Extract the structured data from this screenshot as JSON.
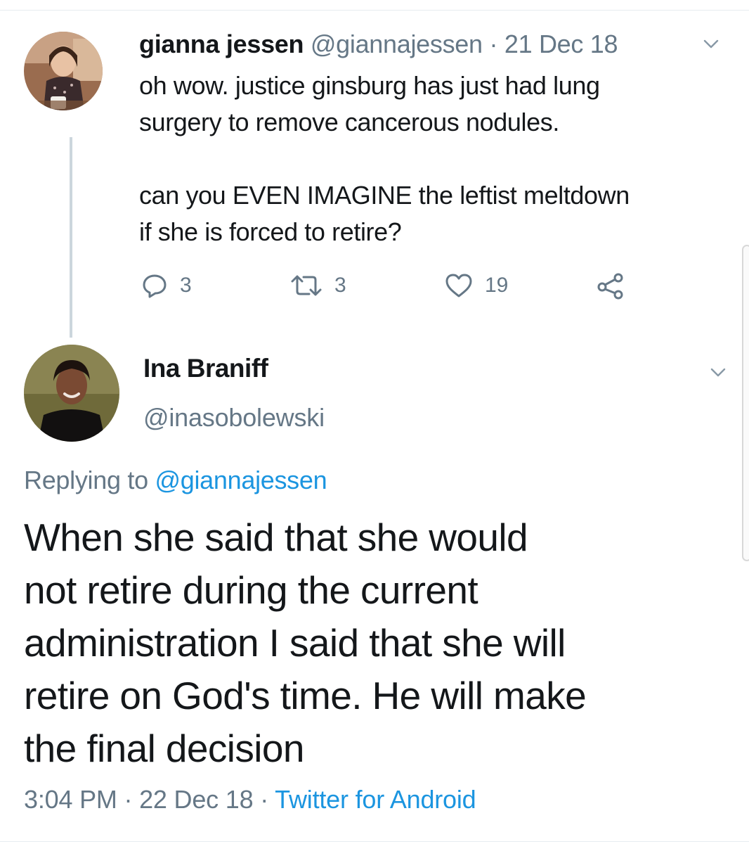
{
  "parent_tweet": {
    "name": "gianna jessen",
    "handle": "@giannajessen",
    "separator": "·",
    "date": "21 Dec 18",
    "text_line1": "oh wow. justice ginsburg has just had lung",
    "text_line2": "surgery to remove cancerous nodules.",
    "text_line3": "can you EVEN IMAGINE the leftist meltdown",
    "text_line4": "if she is forced to retire?",
    "reply_count": "3",
    "retweet_count": "3",
    "like_count": "19"
  },
  "reply_tweet": {
    "name": "Ina Braniff",
    "handle": "@inasobolewski",
    "replying_prefix": "Replying to",
    "replying_to": "@giannajessen",
    "text_line1": "When she said that she would",
    "text_line2": "not retire during the current",
    "text_line3": "administration I said that she will",
    "text_line4": "retire on God's time. He will make",
    "text_line5": "the final decision",
    "time": "3:04 PM",
    "separator": "·",
    "date": "22 Dec 18",
    "source": "Twitter for Android"
  },
  "colors": {
    "text": "#14171a",
    "secondary": "#657786",
    "link": "#1b95e0",
    "divider": "#e6ecf0"
  },
  "icons": [
    "reply-icon",
    "retweet-icon",
    "like-icon",
    "share-icon",
    "chevron-down-icon"
  ]
}
